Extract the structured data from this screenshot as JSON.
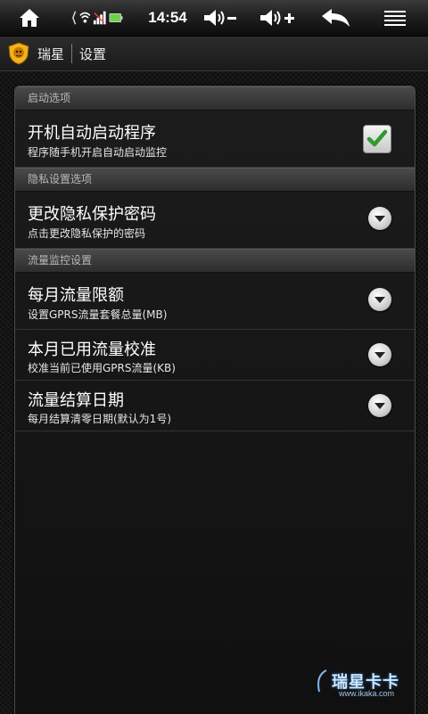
{
  "status_bar": {
    "time": "14:54",
    "icons": [
      "home-icon",
      "usb-icon",
      "wifi-icon",
      "no-signal-icon",
      "battery-icon",
      "volume-down-icon",
      "volume-up-icon",
      "back-icon",
      "menu-icon"
    ]
  },
  "title_bar": {
    "app_name": "瑞星",
    "page_title": "设置",
    "logo_icon": "rising-lion-logo-icon"
  },
  "sections": [
    {
      "header": "启动选项",
      "items": [
        {
          "title": "开机自动启动程序",
          "subtitle": "程序随手机开启自动启动监控",
          "control": "checkbox",
          "checked": true
        }
      ]
    },
    {
      "header": "隐私设置选项",
      "items": [
        {
          "title": "更改隐私保护密码",
          "subtitle": "点击更改隐私保护的密码",
          "control": "dropdown"
        }
      ]
    },
    {
      "header": "流量监控设置",
      "items": [
        {
          "title": "每月流量限额",
          "subtitle": "设置GPRS流量套餐总量(MB)",
          "control": "dropdown"
        },
        {
          "title": "本月已用流量校准",
          "subtitle": "校准当前已使用GPRS流量(KB)",
          "control": "dropdown"
        },
        {
          "title": "流量结算日期",
          "subtitle": "每月结算清零日期(默认为1号)",
          "control": "dropdown"
        }
      ]
    }
  ],
  "watermark": {
    "text": "瑞星卡卡",
    "url": "www.ikaka.com"
  },
  "colors": {
    "checkmark": "#2f9a2f",
    "background": "#141414",
    "section_header": "#3a3a3a"
  }
}
